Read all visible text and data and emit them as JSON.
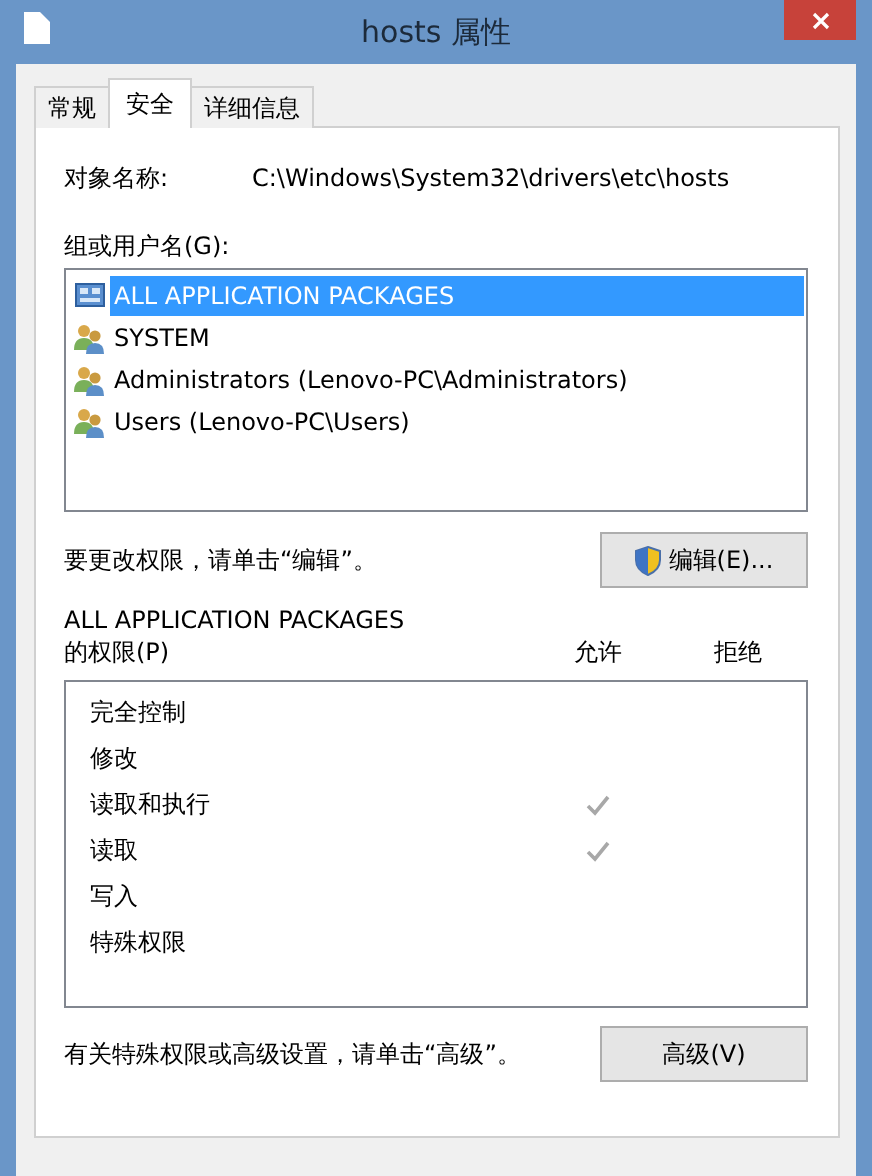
{
  "window": {
    "title": "hosts 属性"
  },
  "tabs": [
    {
      "label": "常规",
      "selected": false
    },
    {
      "label": "安全",
      "selected": true
    },
    {
      "label": "详细信息",
      "selected": false
    }
  ],
  "object_name": {
    "label": "对象名称:",
    "value": "C:\\Windows\\System32\\drivers\\etc\\hosts"
  },
  "groups": {
    "label": "组或用户名(G):",
    "items": [
      {
        "name": "ALL APPLICATION PACKAGES",
        "kind": "package",
        "selected": true
      },
      {
        "name": "SYSTEM",
        "kind": "group",
        "selected": false
      },
      {
        "name": "Administrators (Lenovo-PC\\Administrators)",
        "kind": "group",
        "selected": false
      },
      {
        "name": "Users (Lenovo-PC\\Users)",
        "kind": "group",
        "selected": false
      }
    ]
  },
  "edit_hint": "要更改权限，请单击“编辑”。",
  "edit_button": "编辑(E)...",
  "permissions": {
    "subject": "ALL APPLICATION PACKAGES",
    "label": "的权限(P)",
    "allow_column": "允许",
    "deny_column": "拒绝",
    "rows": [
      {
        "name": "完全控制",
        "allow": false,
        "deny": false
      },
      {
        "name": "修改",
        "allow": false,
        "deny": false
      },
      {
        "name": "读取和执行",
        "allow": true,
        "deny": false
      },
      {
        "name": "读取",
        "allow": true,
        "deny": false
      },
      {
        "name": "写入",
        "allow": false,
        "deny": false
      },
      {
        "name": "特殊权限",
        "allow": false,
        "deny": false
      }
    ]
  },
  "advanced_hint": "有关特殊权限或高级设置，请单击“高级”。",
  "advanced_button": "高级(V)"
}
